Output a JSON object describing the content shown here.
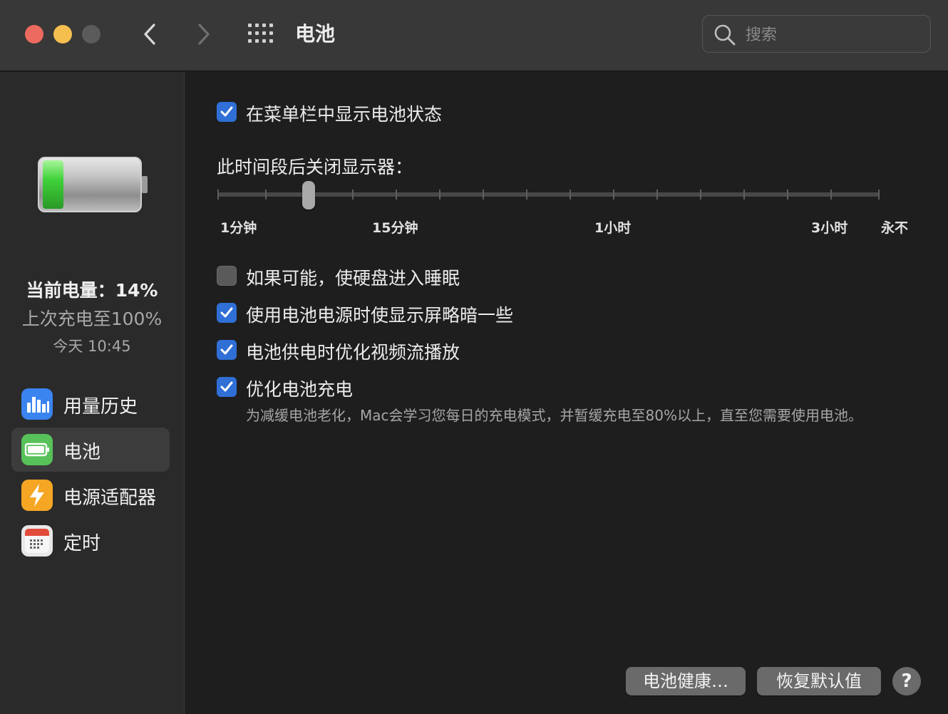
{
  "window": {
    "title": "电池",
    "search_placeholder": "搜索"
  },
  "sidebar": {
    "battery_level": "当前电量：14%",
    "last_charge": "上次充电至100%",
    "last_charge_time": "今天 10:45",
    "items": [
      {
        "label": "用量历史",
        "icon": "bar-chart-icon",
        "color": "#3a84f0"
      },
      {
        "label": "电池",
        "icon": "battery-icon",
        "color": "#57c25a",
        "selected": true
      },
      {
        "label": "电源适配器",
        "icon": "lightning-icon",
        "color": "#f5a623"
      },
      {
        "label": "定时",
        "icon": "calendar-icon",
        "color": "#e8e8e8"
      }
    ]
  },
  "main": {
    "show_status": {
      "label": "在菜单栏中显示电池状态",
      "checked": true
    },
    "display_off_title": "此时间段后关闭显示器：",
    "slider": {
      "labels": [
        "1分钟",
        "15分钟",
        "1小时",
        "3小时",
        "永不"
      ],
      "value": "3分钟"
    },
    "options": [
      {
        "label": "如果可能，使硬盘进入睡眠",
        "checked": false
      },
      {
        "label": "使用电池电源时使显示屏略暗一些",
        "checked": true
      },
      {
        "label": "电池供电时优化视频流播放",
        "checked": true
      },
      {
        "label": "优化电池充电",
        "checked": true
      }
    ],
    "optimize_desc": "为减缓电池老化，Mac会学习您每日的充电模式，并暂缓充电至80%以上，直至您需要使用电池。"
  },
  "buttons": {
    "battery_health": "电池健康…",
    "restore_defaults": "恢复默认值",
    "help": "?"
  },
  "colors": {
    "accent": "#2f6fd6",
    "battery_fill": "#3fd13a"
  }
}
